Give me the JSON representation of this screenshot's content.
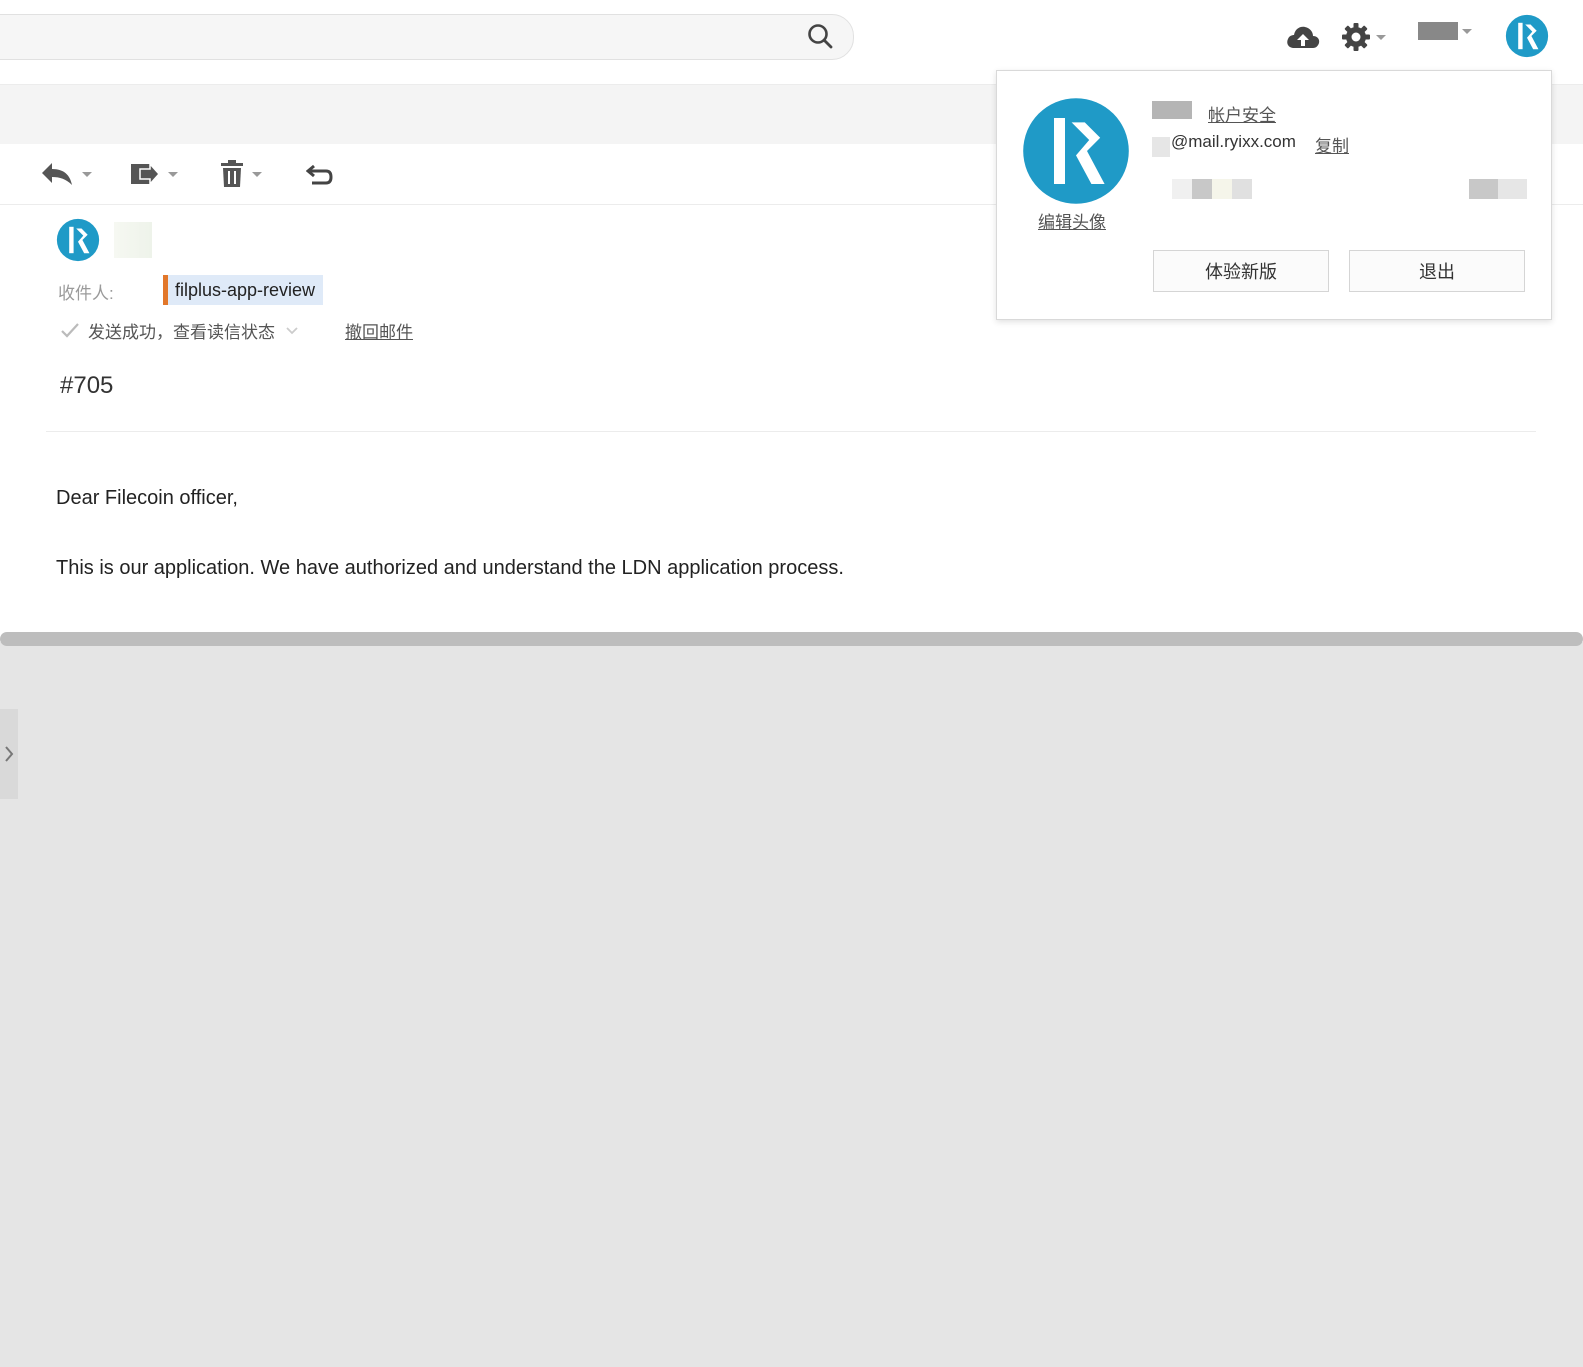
{
  "recipient": {
    "label": "收件人:",
    "name": "filplus-app-review"
  },
  "status": {
    "text": "发送成功，查看读信状态",
    "recall": "撤回邮件"
  },
  "subject": "#705",
  "body": {
    "greeting": "Dear Filecoin officer,",
    "line1": "This is our application. We have authorized and understand the LDN application process."
  },
  "popup": {
    "edit_avatar": "编辑头像",
    "account_security": "帐户安全",
    "email": "@mail.ryixx.com",
    "copy": "复制",
    "try_new": "体验新版",
    "logout": "退出"
  },
  "colors": {
    "brand": "#1f9ac7",
    "chip_bg": "#dfeaf8",
    "chip_accent": "#e2772a"
  },
  "icons": [
    "search-icon",
    "cloud-upload-icon",
    "gear-icon",
    "reply-icon",
    "move-icon",
    "trash-icon",
    "undo-icon",
    "check-icon",
    "chevron-right-icon"
  ]
}
